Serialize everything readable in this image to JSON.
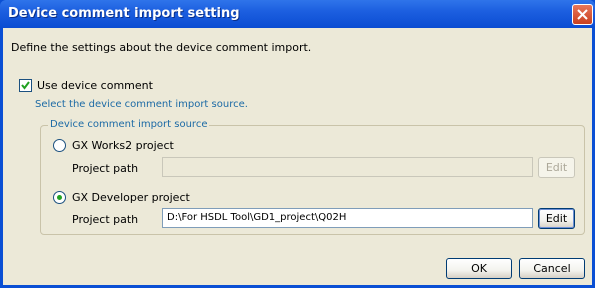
{
  "window": {
    "title": "Device comment import setting"
  },
  "description": "Define the settings about the device comment import.",
  "use_device_comment": {
    "label": "Use device comment",
    "checked": true
  },
  "hint": "Select the device comment import source.",
  "source_group": {
    "legend": "Device comment import source",
    "gxworks2": {
      "label": "GX Works2 project",
      "selected": false,
      "path_label": "Project path",
      "path_value": "",
      "edit_label": "Edit"
    },
    "gxdeveloper": {
      "label": "GX Developer project",
      "selected": true,
      "path_label": "Project path",
      "path_value": "D:\\For HSDL Tool\\GD1_project\\Q02H",
      "edit_label": "Edit"
    }
  },
  "buttons": {
    "ok": "OK",
    "cancel": "Cancel"
  },
  "colors": {
    "title_bar": "#0b4cd2",
    "hint_text": "#1c6aa5",
    "dialog_bg": "#ece9d8"
  }
}
